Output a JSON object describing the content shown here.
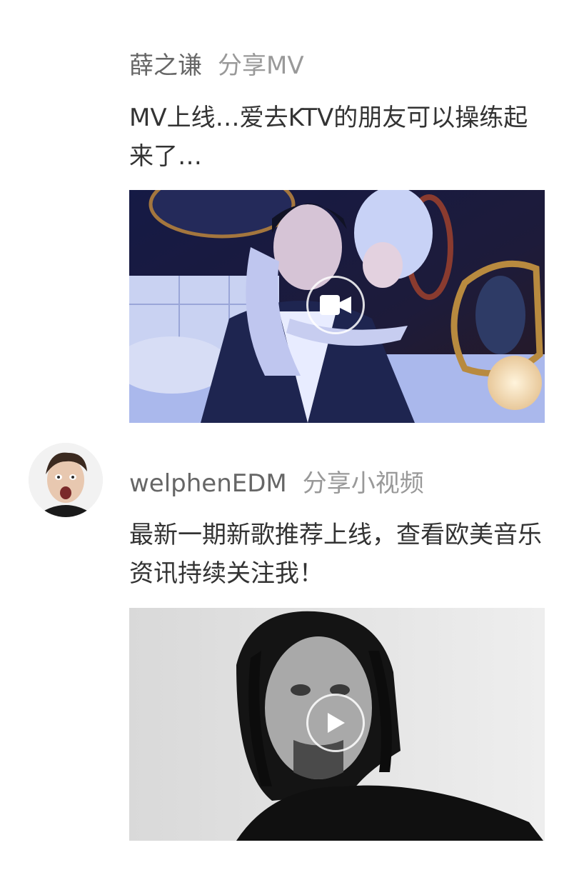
{
  "feed": {
    "posts": [
      {
        "author": "薛之谦",
        "action": "分享MV",
        "caption": "MV上线…爱去KTV的朋友可以操练起来了…",
        "media_type": "mv",
        "overlay_icon": "video-camera-icon"
      },
      {
        "author": "welphenEDM",
        "action": "分享小视频",
        "caption": "最新一期新歌推荐上线，查看欧美音乐资讯持续关注我！",
        "media_type": "short-video",
        "overlay_icon": "play-icon"
      }
    ]
  },
  "colors": {
    "author_text": "#666666",
    "action_text": "#999999",
    "caption_text": "#333333",
    "background": "#ffffff"
  }
}
